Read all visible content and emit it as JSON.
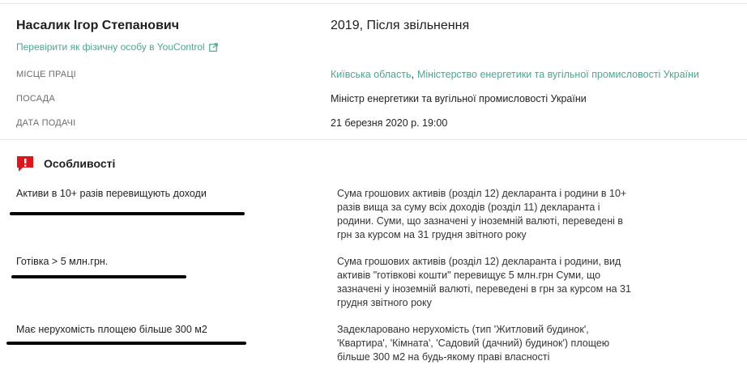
{
  "person": {
    "name": "Насалик Ігор Степанович",
    "youcontrol_link": "Перевірити як фізичну особу в YouControl",
    "declaration_year": "2019, Після звільнення"
  },
  "details": {
    "workplace_label": "МІСЦЕ ПРАЦІ",
    "workplace_region": "Київська область",
    "workplace_org": "Міністерство енергетики та вугільної промисловості України",
    "position_label": "ПОСАДА",
    "position_value": "Міністр енергетики та вугільної промисловості України",
    "date_label": "ДАТА ПОДАЧІ",
    "date_value": "21 березня 2020 р. 19:00"
  },
  "features": {
    "title": "Особливості",
    "icon": "alert-flag-icon",
    "accent_color": "#e0151b",
    "link_color": "#4ba88e",
    "items": [
      {
        "name": "Активи в 10+ разів перевищують доходи",
        "lines": [
          "Сума грошових активів (розділ 12) декларанта і родини в 10+",
          "разів вища за суму всіх доходів (розділ 11) декларанта і",
          "родини. Суми, що зазначені у іноземній валюті, переведені в",
          "грн за курсом на 31 грудня звітного року"
        ]
      },
      {
        "name": "Готівка > 5 млн.грн.",
        "lines": [
          "Сума грошових активів (розділ 12) декларанта і родини, вид",
          "активів \"готівкові кошти\" перевищує 5 млн.грн Суми, що",
          "зазначені у іноземній валюті, переведені в грн за курсом на 31",
          "грудня звітного року"
        ]
      },
      {
        "name": "Має нерухомість площею більше 300 м2",
        "lines": [
          "Задекларовано нерухомість (тип 'Житловий будинок',",
          "'Квартира', 'Кімната', 'Садовий (дачний) будинок') площею",
          "більше 300 м2 на будь-якому праві власності"
        ]
      }
    ]
  }
}
